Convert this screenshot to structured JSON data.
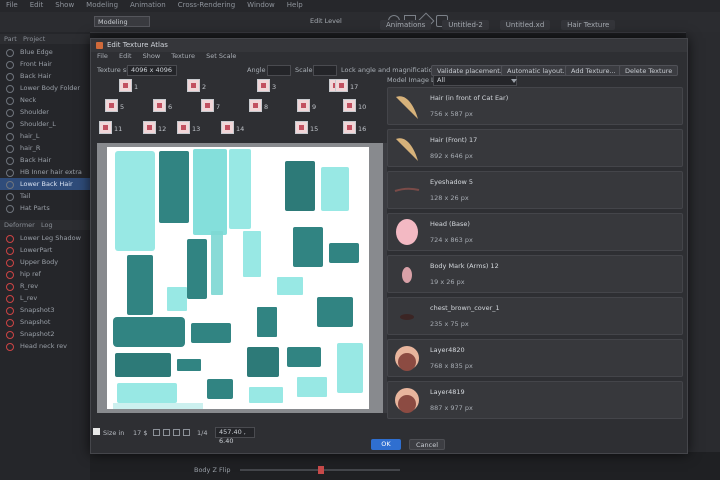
{
  "app": {
    "menu": [
      "File",
      "Edit",
      "Show",
      "Modeling",
      "Animation",
      "Cross-Rendering",
      "Window",
      "Help"
    ],
    "mode_select": "Modeling",
    "edit_level": "Edit Level",
    "tabs": [
      "Animations",
      "Untitled-2",
      "Untitled.xd",
      "Hair Texture"
    ],
    "left_panel": {
      "tabs": [
        "Part",
        "Project"
      ],
      "rows": [
        {
          "label": "Blue Edge",
          "red": false
        },
        {
          "label": "Front Hair",
          "red": false
        },
        {
          "label": "Back Hair",
          "red": false
        },
        {
          "label": "Lower Body Folder",
          "red": false
        },
        {
          "label": "Neck",
          "red": false
        },
        {
          "label": "Shoulder",
          "red": false
        },
        {
          "label": "Shoulder_L",
          "red": false
        },
        {
          "label": "hair_L",
          "red": false
        },
        {
          "label": "hair_R",
          "red": false
        },
        {
          "label": "Back Hair",
          "red": false
        },
        {
          "label": "HB Inner hair extra",
          "red": false
        },
        {
          "label": "Lower Back Hair",
          "red": false,
          "selected": true
        },
        {
          "label": "Tail",
          "red": false
        },
        {
          "label": "Hat Parts",
          "red": false
        }
      ],
      "deformer_tabs": [
        "Deformer",
        "Log"
      ],
      "deformer_rows": [
        {
          "label": "Lower Leg Shadow",
          "red": true
        },
        {
          "label": "LowerPart",
          "red": true
        },
        {
          "label": "Upper Body",
          "red": true
        },
        {
          "label": "hip ref",
          "red": true
        },
        {
          "label": "R_rev",
          "red": true
        },
        {
          "label": "L_rev",
          "red": true
        },
        {
          "label": "Snapshot3",
          "red": true
        },
        {
          "label": "Snapshot",
          "red": true
        },
        {
          "label": "Snapshot2",
          "red": true
        },
        {
          "label": "Head neck rev",
          "red": true
        }
      ]
    }
  },
  "dialog": {
    "title": "Edit Texture Atlas",
    "menu": [
      "File",
      "Edit",
      "Show",
      "Texture",
      "Set Scale"
    ],
    "texture_size_label": "Texture size",
    "texture_size_value": "4096 x 4096",
    "angle_label": "Angle",
    "scale_label": "Scale",
    "lock_label": "Lock angle and magnification",
    "buttons": {
      "validate": "Validate placement...",
      "auto_layout": "Automatic layout...",
      "add_texture": "Add Texture...",
      "delete_texture": "Delete Texture"
    },
    "atlas_numbers": [
      "1",
      "2",
      "3",
      "4",
      "5",
      "6",
      "7",
      "8",
      "9",
      "10",
      "11",
      "12",
      "13",
      "14",
      "15",
      "16",
      "17"
    ],
    "list_label": "Model Image List",
    "list_filter": "All",
    "items": [
      {
        "name": "Hair (in front of Cat Ear)",
        "size": "756 x 587 px",
        "preview": "hair"
      },
      {
        "name": "Hair (Front) 17",
        "size": "892 x 646 px",
        "preview": "hair"
      },
      {
        "name": "Eyeshadow 5",
        "size": "128 x 26 px",
        "preview": "line"
      },
      {
        "name": "Head (Base)",
        "size": "724 x 863 px",
        "preview": "head"
      },
      {
        "name": "Body Mark (Arms) 12",
        "size": "19 x 26 px",
        "preview": "mark"
      },
      {
        "name": "chest_brown_cover_1",
        "size": "235 x 75 px",
        "preview": "dark"
      },
      {
        "name": "Layer4820",
        "size": "768 x 835 px",
        "preview": "ball"
      },
      {
        "name": "Layer4819",
        "size": "887 x 977 px",
        "preview": "ball"
      }
    ],
    "footer": {
      "size_label": "Size in",
      "zoom": "17 $",
      "page": "1/4",
      "coords": "457.40 , 6.40"
    },
    "ok": "OK",
    "cancel": "Cancel"
  },
  "timeline": {
    "label": "Body Z Flip"
  },
  "colors": {
    "accent": "#2f6fd0",
    "teal": "#1f7f7b",
    "cyan": "#7fe3e0"
  }
}
